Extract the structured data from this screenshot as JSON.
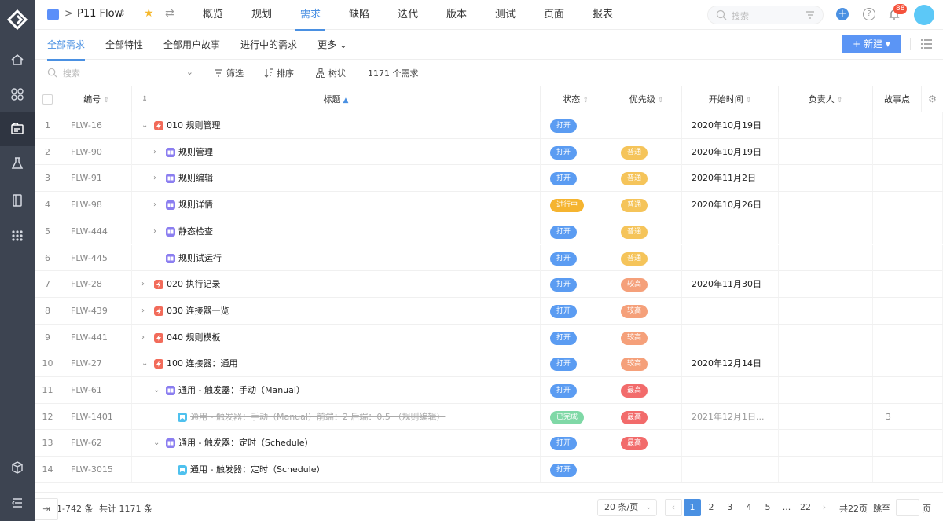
{
  "rail": {
    "items": [
      "home-icon",
      "apps-icon",
      "requirements-icon",
      "test-flask-icon",
      "book-icon",
      "grid-icon"
    ],
    "bottom": [
      "cube-icon",
      "menu-collapse-icon"
    ]
  },
  "header": {
    "crumb_sep": ">",
    "project_name": "P11 Flow",
    "switch_glyph": "⇕",
    "nav": [
      {
        "label": "概览"
      },
      {
        "label": "规划"
      },
      {
        "label": "需求"
      },
      {
        "label": "缺陷"
      },
      {
        "label": "迭代"
      },
      {
        "label": "版本"
      },
      {
        "label": "测试"
      },
      {
        "label": "页面"
      },
      {
        "label": "报表"
      }
    ],
    "active_nav": 2,
    "search_placeholder": "搜索",
    "notification_count": "88",
    "accent": "#4a90e2"
  },
  "subbar": {
    "tabs": [
      "全部需求",
      "全部特性",
      "全部用户故事",
      "进行中的需求",
      "更多 ⌄"
    ],
    "new_button": "+ 新建 ▾"
  },
  "toolbar": {
    "search_placeholder": "搜索",
    "filter": "筛选",
    "sort": "排序",
    "tree": "树状",
    "count": "1171 个需求"
  },
  "table": {
    "headers": {
      "code": "编号",
      "title": "标题",
      "status": "状态",
      "priority": "优先级",
      "start": "开始时间",
      "owner": "负责人",
      "points": "故事点"
    },
    "rows": [
      {
        "idx": "1",
        "code": "FLW-16",
        "level": 0,
        "toggle": "open",
        "type": "feat",
        "title": "010 规则管理",
        "status": "打开",
        "priority": "",
        "start": "2020年10月19日",
        "points": ""
      },
      {
        "idx": "2",
        "code": "FLW-90",
        "level": 1,
        "toggle": "closed",
        "type": "story",
        "title": "规则管理",
        "status": "打开",
        "priority": "普通",
        "start": "2020年10月19日",
        "points": ""
      },
      {
        "idx": "3",
        "code": "FLW-91",
        "level": 1,
        "toggle": "closed",
        "type": "story",
        "title": "规则编辑",
        "status": "打开",
        "priority": "普通",
        "start": "2020年11月2日",
        "points": ""
      },
      {
        "idx": "4",
        "code": "FLW-98",
        "level": 1,
        "toggle": "closed",
        "type": "story",
        "title": "规则详情",
        "status": "进行中",
        "priority": "普通",
        "start": "2020年10月26日",
        "points": ""
      },
      {
        "idx": "5",
        "code": "FLW-444",
        "level": 1,
        "toggle": "closed",
        "type": "story",
        "title": "静态检查",
        "status": "打开",
        "priority": "普通",
        "start": "",
        "points": ""
      },
      {
        "idx": "6",
        "code": "FLW-445",
        "level": 1,
        "toggle": "none",
        "type": "story",
        "title": "规则试运行",
        "status": "打开",
        "priority": "普通",
        "start": "",
        "points": ""
      },
      {
        "idx": "7",
        "code": "FLW-28",
        "level": 0,
        "toggle": "closed",
        "type": "feat",
        "title": "020 执行记录",
        "status": "打开",
        "priority": "较高",
        "start": "2020年11月30日",
        "points": ""
      },
      {
        "idx": "8",
        "code": "FLW-439",
        "level": 0,
        "toggle": "closed",
        "type": "feat",
        "title": "030 连接器一览",
        "status": "打开",
        "priority": "较高",
        "start": "",
        "points": ""
      },
      {
        "idx": "9",
        "code": "FLW-441",
        "level": 0,
        "toggle": "closed",
        "type": "feat",
        "title": "040 规则模板",
        "status": "打开",
        "priority": "较高",
        "start": "",
        "points": ""
      },
      {
        "idx": "10",
        "code": "FLW-27",
        "level": 0,
        "toggle": "open",
        "type": "feat",
        "title": "100 连接器：通用",
        "status": "打开",
        "priority": "较高",
        "start": "2020年12月14日",
        "points": ""
      },
      {
        "idx": "11",
        "code": "FLW-61",
        "level": 1,
        "toggle": "open",
        "type": "story",
        "title": "通用 - 触发器：手动（Manual）",
        "status": "打开",
        "priority": "最高",
        "start": "",
        "points": ""
      },
      {
        "idx": "12",
        "code": "FLW-1401",
        "level": 2,
        "toggle": "none",
        "type": "task",
        "title": "通用 - 触发器：手动（Manual）前端：2 后端：0.5 （规则编辑）",
        "status": "已完成",
        "priority": "最高",
        "start": "2021年12月1日...",
        "points": "3",
        "done": true
      },
      {
        "idx": "13",
        "code": "FLW-62",
        "level": 1,
        "toggle": "open",
        "type": "story",
        "title": "通用 - 触发器：定时（Schedule）",
        "status": "打开",
        "priority": "最高",
        "start": "",
        "points": ""
      },
      {
        "idx": "14",
        "code": "FLW-3015",
        "level": 2,
        "toggle": "none",
        "type": "task",
        "title": "通用 - 触发器：定时（Schedule）",
        "status": "打开",
        "priority": "",
        "start": "",
        "points": ""
      }
    ],
    "status_colors": {
      "打开": "#5b9cf2",
      "进行中": "#f5b430",
      "已完成": "#7fd8a6"
    },
    "priority_colors": {
      "普通": "#f5c45a",
      "较高": "#f5a07a",
      "最高": "#f26b6b"
    }
  },
  "footer": {
    "range": "1-742 条",
    "total": "共计 1171 条",
    "page_size": "20 条/页",
    "pages": [
      "1",
      "2",
      "3",
      "4",
      "5",
      "...",
      "22"
    ],
    "active_page": "1",
    "total_pages": "共22页",
    "jump": "跳至",
    "page_unit": "页"
  }
}
